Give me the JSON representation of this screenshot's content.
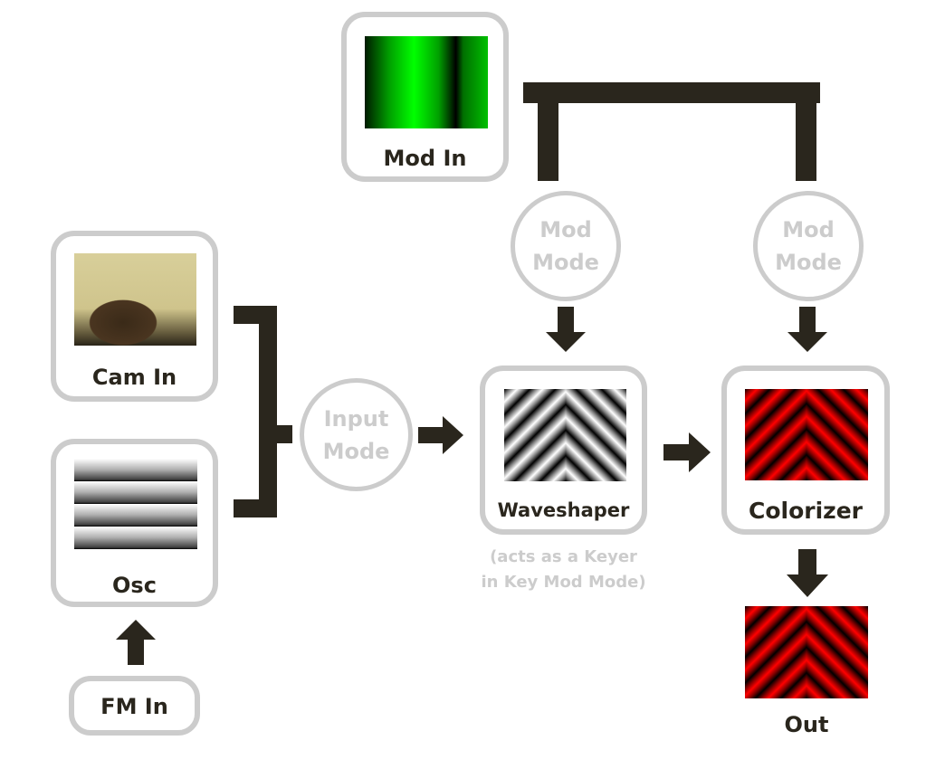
{
  "nodes": {
    "mod_in": {
      "label": "Mod In"
    },
    "cam_in": {
      "label": "Cam In"
    },
    "osc": {
      "label": "Osc"
    },
    "fm_in": {
      "label": "FM In"
    },
    "input_mode": {
      "line1": "Input",
      "line2": "Mode"
    },
    "mod_mode_1": {
      "line1": "Mod",
      "line2": "Mode"
    },
    "mod_mode_2": {
      "line1": "Mod",
      "line2": "Mode"
    },
    "waveshaper": {
      "label": "Waveshaper",
      "caption_line1": "(acts as a Keyer",
      "caption_line2": "in Key Mod Mode)"
    },
    "colorizer": {
      "label": "Colorizer"
    },
    "out": {
      "label": "Out"
    }
  },
  "colors": {
    "connector": "#2a261d",
    "node_border": "#cccccc",
    "mode_text": "#cccccc",
    "mod_preview": "#00ff00",
    "color_preview": "#ff0000"
  }
}
